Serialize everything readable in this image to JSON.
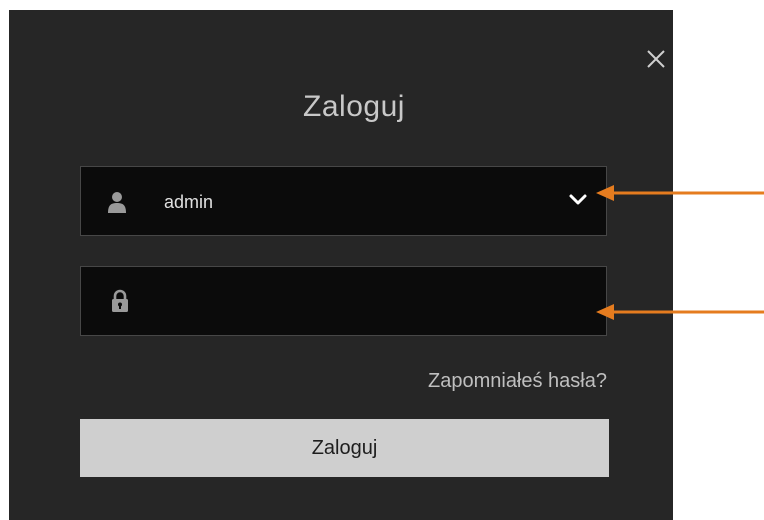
{
  "dialog": {
    "title": "Zaloguj",
    "close_icon": "close-icon",
    "username_field": {
      "value": "admin",
      "icon": "user-icon",
      "dropdown_icon": "chevron-down-icon"
    },
    "password_field": {
      "value": "",
      "icon": "lock-icon"
    },
    "forgot_password_label": "Zapomniałeś hasła?",
    "login_button_label": "Zaloguj"
  },
  "colors": {
    "dialog_background": "#262626",
    "field_background": "#0b0b0b",
    "button_background": "#cfcfcf",
    "annotation_arrow": "#e57c1f"
  }
}
